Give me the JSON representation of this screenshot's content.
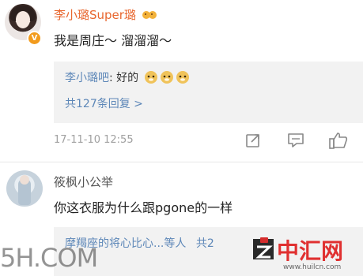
{
  "comments": [
    {
      "username": "李小璐Super璐",
      "content": "我是周庄～ 溜溜溜～",
      "reply": {
        "author": "李小璐吧",
        "separator": ": ",
        "text": "好的",
        "expand_label": "共127条回复 >"
      },
      "timestamp": "17-11-10 12:55"
    },
    {
      "username": "筱枫小公举",
      "content": "你这衣服为什么跟pgone的一样",
      "reply": {
        "preview": "摩羯座的将心比心...等人",
        "count_prefix": "共",
        "count_suffix": "2"
      }
    }
  ],
  "watermarks": {
    "left": "5H.COM",
    "right_title": "中汇网",
    "right_url": "www.huilcn.com"
  },
  "colors": {
    "username_accent": "#e8672f",
    "link_blue": "#5d87b8",
    "reply_bg": "#f2f2f2",
    "verified_badge": "#f29b1d"
  },
  "icons": {
    "share": "share-icon",
    "comment": "comment-icon",
    "like": "thumb-up-icon",
    "verified": "verified-badge-icon",
    "emoji": "doge-emoji-icon"
  }
}
